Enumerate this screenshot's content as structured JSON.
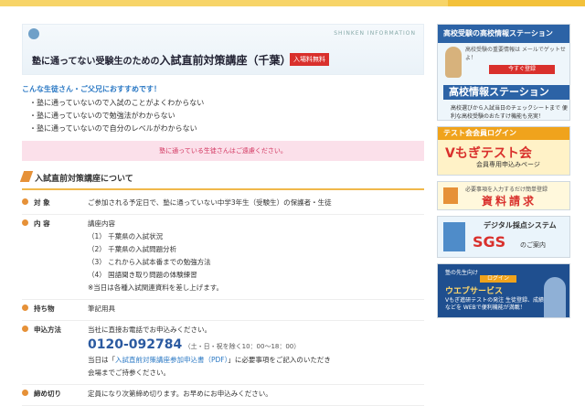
{
  "hero": {
    "brand": "SHINKEN INFORMATION",
    "title_prefix": "塾に通ってない受験生のための",
    "title_main": "入試直前対策講座（千葉）",
    "badge": "入場料無料"
  },
  "recommend": {
    "title": "こんな生徒さん・ご父兄におすすめです！",
    "items": [
      "・塾に通っていないので入試のことがよくわからない",
      "・塾に通っていないので勉強法がわからない",
      "・塾に通っていないので自分のレベルがわからない"
    ]
  },
  "notice": "塾に通っている生徒さんはご遠慮ください。",
  "section_title": "入試直前対策講座について",
  "rows": {
    "target_label": "対 象",
    "target_value": "ご参加される予定日で、塾に通っていない中学3年生（受験生）の保護者・生徒",
    "content_label": "内 容",
    "content_head": "講座内容",
    "content_items": [
      "（1） 千葉県の入試状況",
      "（2） 千葉県の入試問題分析",
      "（3） これから入試本番までの勉強方法",
      "（4） 国語聞き取り問題の体験練習"
    ],
    "content_note": "※当日は各種入試関連資料を差し上げます。",
    "items_label": "持ち物",
    "items_value": "筆記用具",
    "apply_label": "申込方法",
    "apply_line1": "当社に直接お電話でお申込みください。",
    "tel": "0120-092784",
    "tel_hours": "（土・日・祝を除く10：00〜18：00）",
    "apply_line2a": "当日は「",
    "apply_link": "入試直前対策講座参加申込書（PDF）",
    "apply_line2b": "」に必要事項をご記入のいただき",
    "apply_line3": "会場までご持参ください。",
    "deadline_label": "締め切り",
    "deadline_value": "定員になり次第締め切ります。お早めにお申込みください。"
  },
  "side": {
    "b1_header": "高校受験の高校情報ステーション",
    "b1_mid": "高校受験の重要情報は メールでゲットせよ！",
    "b1_btn": "今すぐ登録",
    "b1_bar": "高校情報ステーション",
    "b1_foot": "高校選びから入試当日のチェックシートまで 便利な高校受験のおたすけ機能も充実！",
    "b2_header": "テスト会会員ログイン",
    "b2_big": "Vもぎテスト会",
    "b2_small": "会員専用申込みページ",
    "b3_note": "必要事項を入力するだけ簡単登録",
    "b3_big": "資料請求",
    "b4_title": "デジタル採点システム",
    "b4_logo": "SGS",
    "b4_sub": "のご案内",
    "b5_t1": "塾の先生向け",
    "b5_login": "ログイン",
    "b5_title": "ウエブサービス",
    "b5_desc": "Vもぎ進研テストの発注 生徒登録、成績進捗などを WEBで便利機能が満載！"
  }
}
